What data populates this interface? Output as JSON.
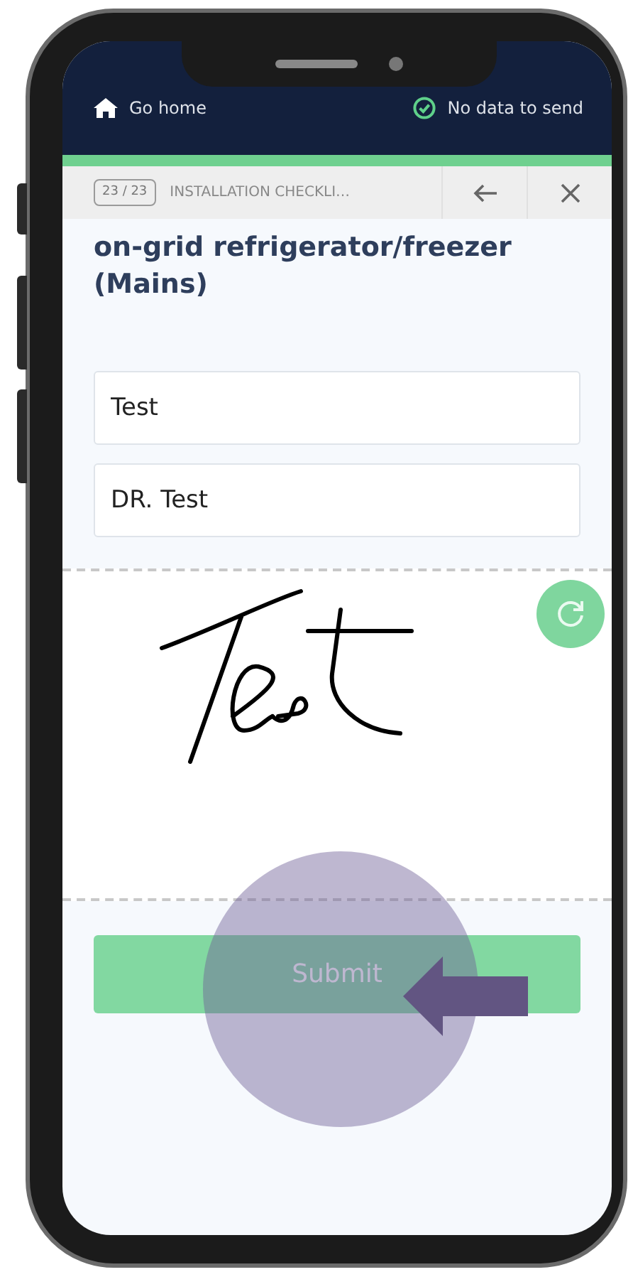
{
  "header": {
    "home_label": "Go home",
    "sync_status": "No data to send"
  },
  "progress": {
    "level": 1
  },
  "toolbar": {
    "counter": "23 / 23",
    "title": "INSTALLATION CHECKLI…"
  },
  "question": "on-grid refrigerator/freezer (Mains)",
  "fields": [
    {
      "value": "Test"
    },
    {
      "value": "DR. Test"
    }
  ],
  "submit": {
    "label": "Submit"
  }
}
